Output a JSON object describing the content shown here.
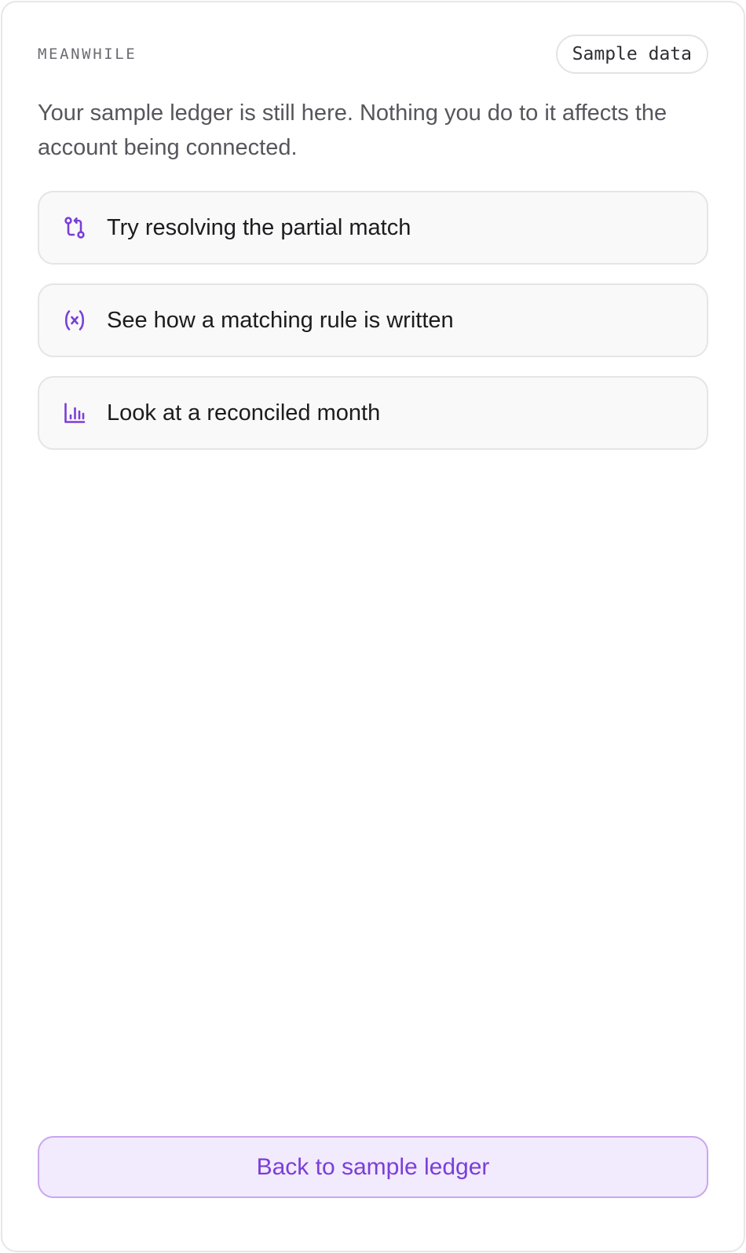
{
  "header": {
    "eyebrow": "MEANWHILE",
    "badge": "Sample data"
  },
  "intro": "Your sample ledger is still here. Nothing you do to it affects the account being connected.",
  "actions": [
    {
      "label": "Try resolving the partial match",
      "icon": "git-pull-request-icon"
    },
    {
      "label": "See how a matching rule is written",
      "icon": "variable-icon"
    },
    {
      "label": "Look at a reconciled month",
      "icon": "bar-chart-icon"
    }
  ],
  "footer": {
    "back_label": "Back to sample ledger"
  },
  "colors": {
    "accent": "#7a3fd8",
    "accent_bg": "#f2eafd",
    "accent_border": "#c9a6f2",
    "card_bg": "#f9f9f9",
    "border": "#e5e5e8"
  }
}
